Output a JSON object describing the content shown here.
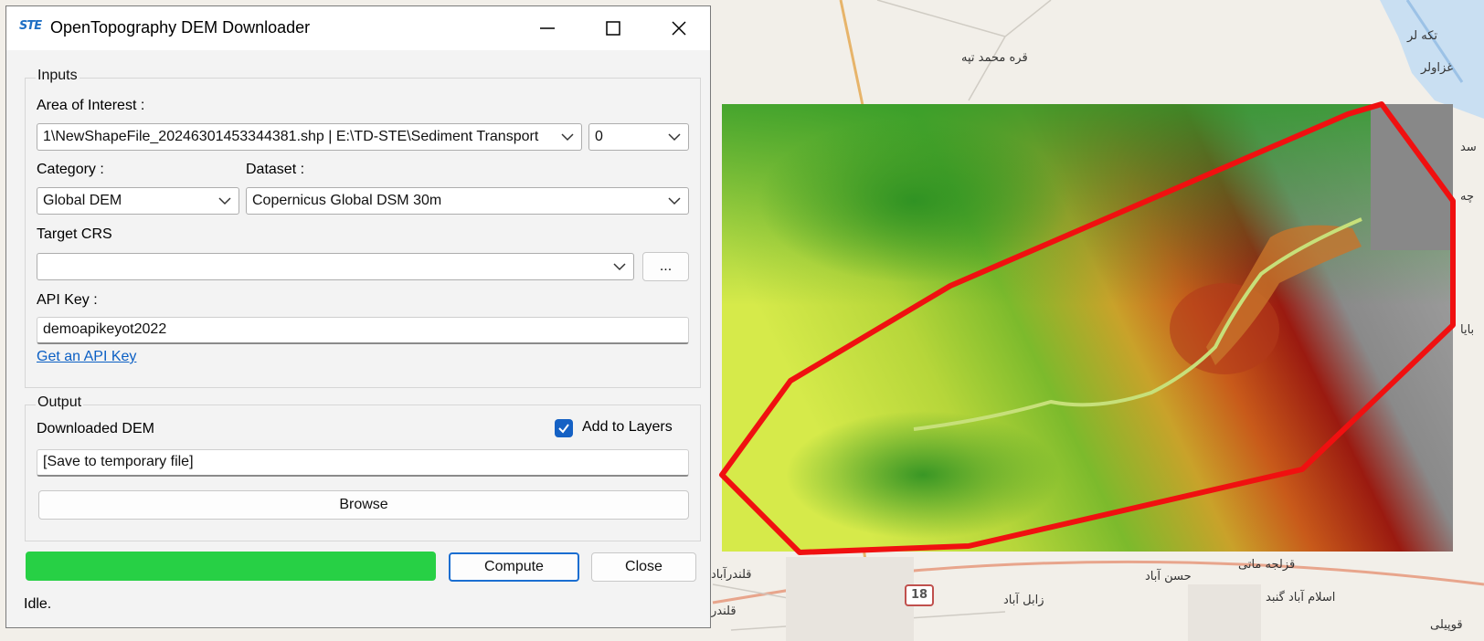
{
  "dialog": {
    "title": "OpenTopography DEM Downloader",
    "app_icon": "STE",
    "inputs_group": "Inputs",
    "aoi_label": "Area of Interest :",
    "aoi_value": "1\\NewShapeFile_20246301453344381.shp | E:\\TD-STE\\Sediment Transport",
    "aoi_buffer_value": "0",
    "category_label": "Category :",
    "category_value": "Global DEM",
    "dataset_label": "Dataset :",
    "dataset_value": "Copernicus Global DSM 30m",
    "crs_label": "Target CRS",
    "crs_value": "",
    "crs_button": "...",
    "apikey_label": "API Key :",
    "apikey_value": "demoapikeyot2022",
    "apikey_link": "Get an API Key",
    "output_group": "Output",
    "downloaded_label": "Downloaded DEM",
    "add_to_layers_label": "Add to Layers",
    "add_to_layers_checked": true,
    "output_value": "[Save to temporary file]",
    "browse_button": "Browse",
    "progress_fraction": 1.0,
    "compute_button": "Compute",
    "close_button": "Close",
    "status": "Idle."
  },
  "map": {
    "places": [
      {
        "name": "تکه لر"
      },
      {
        "name": "غزاولر"
      },
      {
        "name": "قره محمد تپه"
      },
      {
        "name": "قلندرآباد"
      },
      {
        "name": "قلندر"
      },
      {
        "name": "زابل آباد"
      },
      {
        "name": "حسن آباد"
      },
      {
        "name": "قزلجه ماتی"
      },
      {
        "name": "اسلام آباد گنبد"
      },
      {
        "name": "قوپیلی"
      },
      {
        "name": "بایا"
      },
      {
        "name": "سد"
      },
      {
        "name": "چه"
      }
    ],
    "road_number": "18",
    "colors": {
      "aoi_outline": "#f01010",
      "low": "#c8e43a",
      "mid": "#1f9a26",
      "high": "#8c1a10",
      "water": "#c9dff2"
    }
  }
}
